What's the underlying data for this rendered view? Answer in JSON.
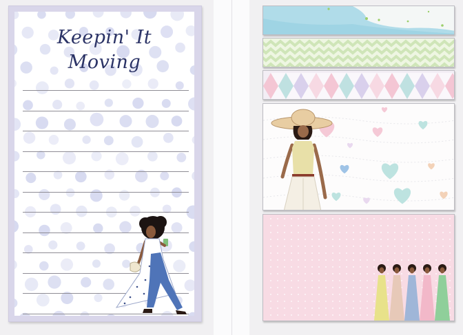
{
  "notepad": {
    "title_line1": "Keepin' It",
    "title_line2": "Moving"
  },
  "colors": {
    "page_background": "#f1f0f2",
    "notepad_border": "#d9d6ea",
    "title_ink": "#2b3366",
    "dot": "#c9cdeb",
    "watercolor_blue": "#a9d8e8",
    "chevron_green": "#cfe5b8",
    "diamond_pink": "#f4c6d4",
    "diamond_teal": "#bfe1e1",
    "diamond_lavender": "#d9d0ec",
    "heart_teal": "#bde3e0",
    "heart_pink": "#f5c9d6",
    "flag_pink": "#f8dbe4"
  },
  "icons": {
    "notepad_figure": "walking-woman-illustration",
    "hearts_figure": "woman-in-sun-hat-illustration",
    "group_figure": "women-in-gowns-illustration"
  }
}
